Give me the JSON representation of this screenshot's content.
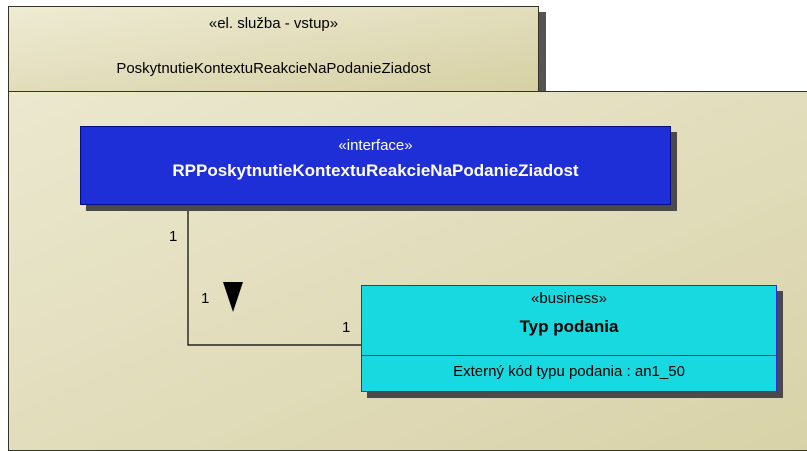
{
  "package": {
    "stereotype": "«el. služba - vstup»",
    "name": "PoskytnutieKontextuReakcieNaPodanieZiadost"
  },
  "interface_class": {
    "stereotype": "«interface»",
    "name": "RPPoskytnutieKontextuReakcieNaPodanieZiadost"
  },
  "business_class": {
    "stereotype": "«business»",
    "name": "Typ podania",
    "attribute": "Externý kód typu podania : an1_50"
  },
  "association": {
    "multiplicity_interface_end": "1",
    "multiplicity_label_near_arrow": "1",
    "multiplicity_business_end": "1"
  }
}
